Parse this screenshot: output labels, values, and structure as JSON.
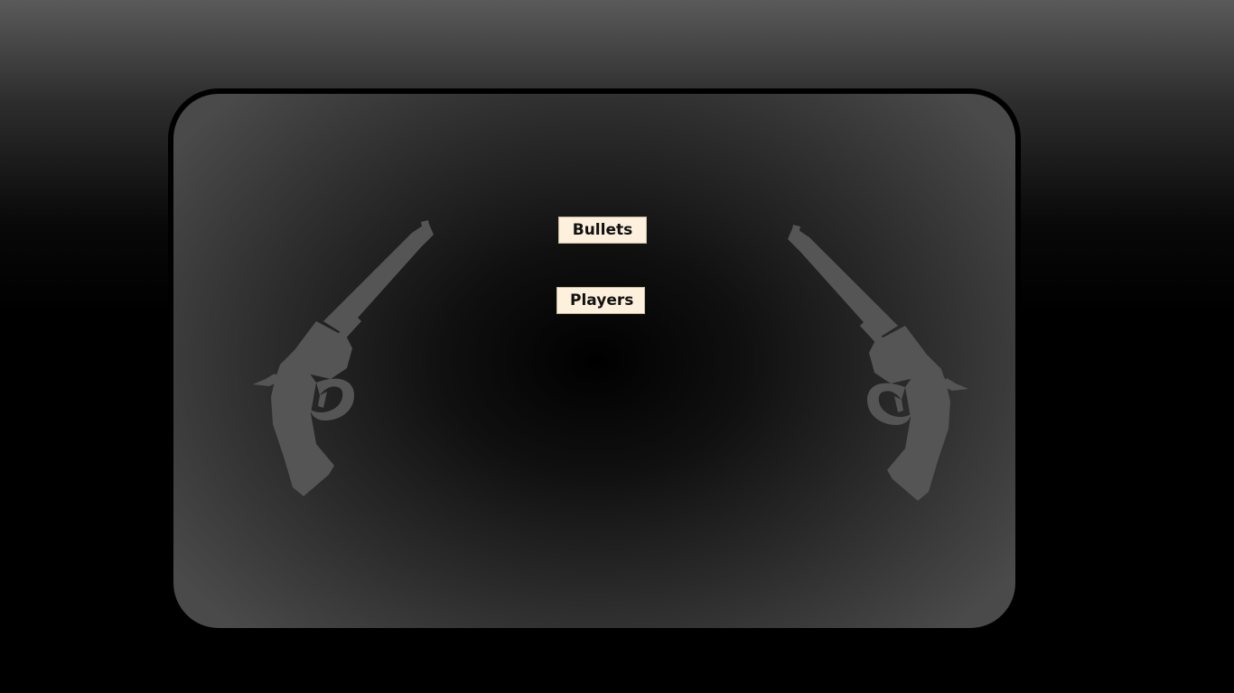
{
  "menu": {
    "bullets_label": "Bullets",
    "players_label": "Players"
  },
  "decor": {
    "left_icon": "revolver-icon",
    "right_icon": "revolver-icon",
    "icon_color": "#555555"
  },
  "colors": {
    "button_bg": "#fdf0dc",
    "button_text": "#111111",
    "panel_border": "#000000"
  }
}
